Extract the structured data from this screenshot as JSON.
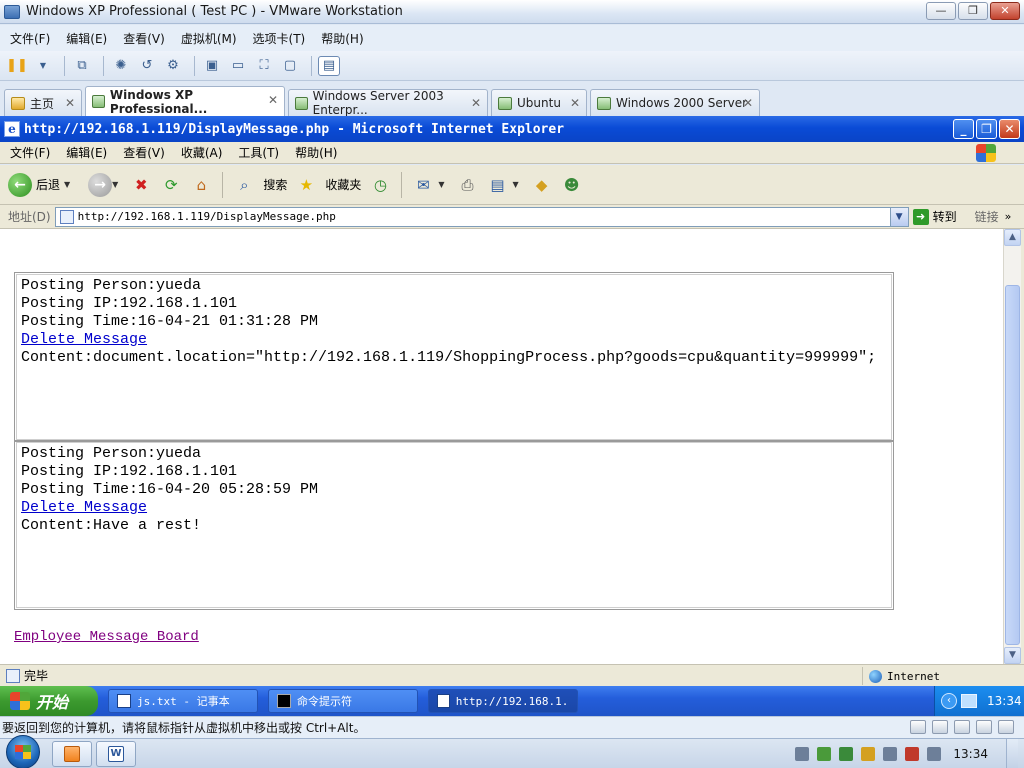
{
  "vmware": {
    "title": "Windows XP Professional ( Test PC ) - VMware Workstation",
    "menu": [
      "文件(F)",
      "编辑(E)",
      "查看(V)",
      "虚拟机(M)",
      "选项卡(T)",
      "帮助(H)"
    ],
    "tabs": [
      {
        "label": "主页",
        "active": false
      },
      {
        "label": "Windows XP Professional...",
        "active": true
      },
      {
        "label": "Windows Server 2003 Enterpr...",
        "active": false
      },
      {
        "label": "Ubuntu",
        "active": false
      },
      {
        "label": "Windows 2000 Server",
        "active": false
      }
    ],
    "hint": "要返回到您的计算机，请将鼠标指针从虚拟机中移出或按 Ctrl+Alt。"
  },
  "ie": {
    "title": "http://192.168.1.119/DisplayMessage.php - Microsoft Internet Explorer",
    "menu": [
      "文件(F)",
      "编辑(E)",
      "查看(V)",
      "收藏(A)",
      "工具(T)",
      "帮助(H)"
    ],
    "toolbar": {
      "back": "后退",
      "search": "搜索",
      "favorites": "收藏夹"
    },
    "address_label": "地址(D)",
    "address": "http://192.168.1.119/DisplayMessage.php",
    "go_label": "转到",
    "links_label": "链接",
    "status": "完毕",
    "zone": "Internet"
  },
  "page": {
    "messages": [
      {
        "person": "Posting Person:yueda",
        "ip": "Posting IP:192.168.1.101",
        "time": "Posting Time:16-04-21 01:31:28 PM",
        "delete": "Delete Message",
        "content": "Content:document.location=\"http://192.168.1.119/ShoppingProcess.php?goods=cpu&quantity=999999\";"
      },
      {
        "person": "Posting Person:yueda",
        "ip": "Posting IP:192.168.1.101",
        "time": "Posting Time:16-04-20 05:28:59 PM",
        "delete": "Delete Message",
        "content": "Content:Have a rest!"
      }
    ],
    "board_link": "Employee Message Board"
  },
  "xp_taskbar": {
    "start": "开始",
    "tasks": [
      "js.txt - 记事本",
      "命令提示符",
      "http://192.168.1..."
    ],
    "clock": "13:34"
  },
  "host_taskbar": {
    "clock": "13:34"
  }
}
